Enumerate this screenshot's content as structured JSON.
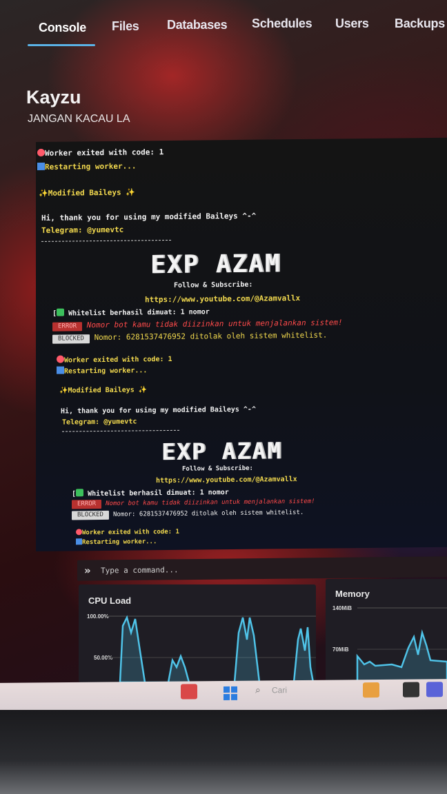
{
  "nav": {
    "tabs": [
      {
        "label": "Console",
        "active": true
      },
      {
        "label": "Files",
        "active": false
      },
      {
        "label": "Databases",
        "active": false
      },
      {
        "label": "Schedules",
        "active": false
      },
      {
        "label": "Users",
        "active": false
      },
      {
        "label": "Backups",
        "active": false
      }
    ]
  },
  "server": {
    "name": "Kayzu",
    "description": "JANGAN KACAU LA"
  },
  "console": {
    "lines": {
      "exit1": "Worker exited with code: 1",
      "restart1": "Restarting worker...",
      "modified1": "Modified Baileys",
      "thanks1": "Hi, thank you for using my modified Baileys ^-^",
      "telegram1": "Telegram: @yumevtc",
      "banner1": "EXP AZAM",
      "follow1": "Follow & Subscribe:",
      "url1": "https://www.youtube.com/@Azamvallx",
      "whitelist1": "Whitelist berhasil dimuat: 1 nomor",
      "error_tag1": "ERROR",
      "error_msg1": "Nomor bot kamu tidak diizinkan untuk menjalankan sistem!",
      "blocked_tag1": "BLOCKED",
      "blocked_msg1": "Nomor: 6281537476952 ditolak oleh sistem whitelist.",
      "exit2": "Worker exited with code: 1",
      "restart2": "Restarting worker...",
      "modified2": "Modified Baileys",
      "thanks2": "Hi, thank you for using my modified Baileys ^-^",
      "telegram2": "Telegram: @yumevtc",
      "banner2": "EXP AZAM",
      "follow2": "Follow & Subscribe:",
      "url2": "https://www.youtube.com/@Azamvallx",
      "whitelist2": "Whitelist berhasil dimuat: 1 nomor",
      "error_tag2": "ERROR",
      "error_msg2": "Nomor bot kamu tidak diizinkan untuk menjalankan sistem!",
      "blocked_tag2": "BLOCKED",
      "blocked_msg2": "Nomor: 6281537476952 ditolak oleh sistem whitelist.",
      "exit3": "Worker exited with code: 1",
      "restart3": "Restarting worker..."
    }
  },
  "command": {
    "prompt_icon": "»",
    "placeholder": "Type a command..."
  },
  "stats": {
    "cpu": {
      "title": "CPU Load",
      "max_label": "100.00%",
      "mid_label": "50.00%"
    },
    "memory": {
      "title": "Memory",
      "max_label": "140MiB",
      "mid_label": "70MiB"
    }
  },
  "taskbar": {
    "search_placeholder": "Cari"
  },
  "colors": {
    "accent": "#5ab2e6",
    "chart_line": "#4fc3e8",
    "console_yellow": "#f2d94e",
    "console_cyan": "#6fe3f0",
    "console_red": "#ff4a4a"
  }
}
